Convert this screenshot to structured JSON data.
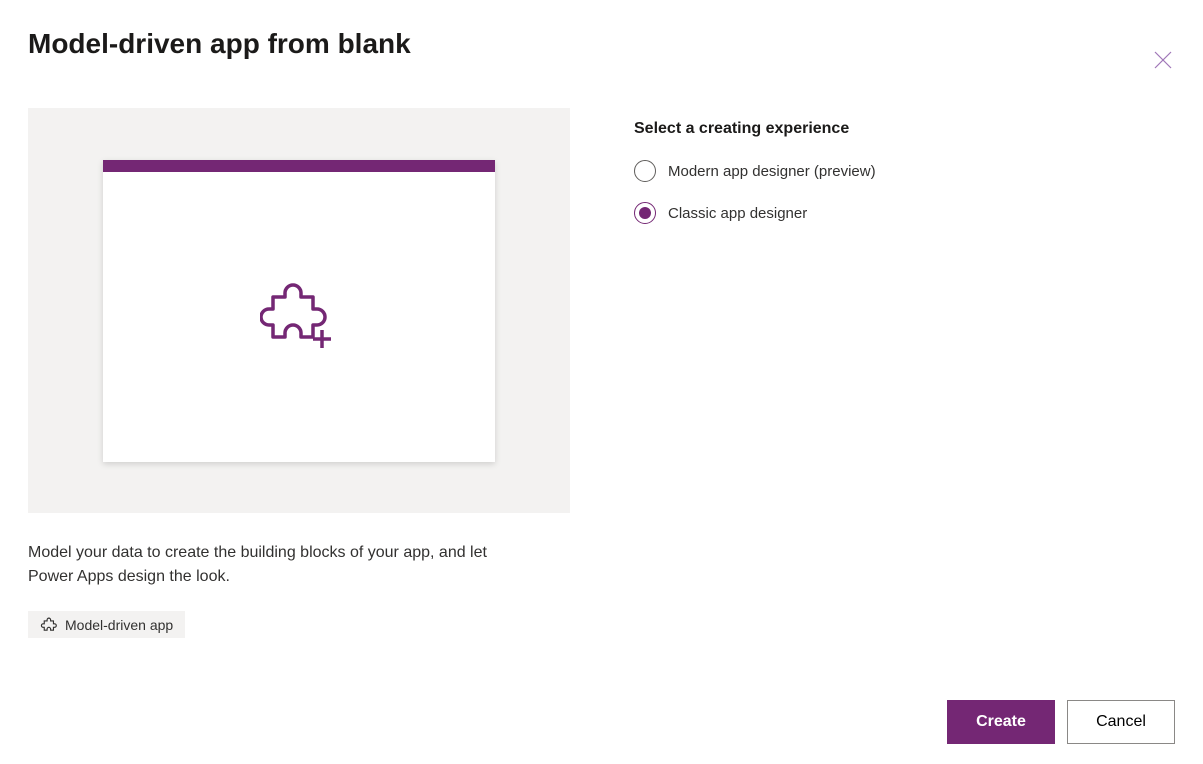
{
  "dialog": {
    "title": "Model-driven app from blank",
    "description": "Model your data to create the building blocks of your app, and let Power Apps design the look.",
    "tag_label": "Model-driven app"
  },
  "options": {
    "section_label": "Select a creating experience",
    "radios": [
      {
        "label": "Modern app designer (preview)",
        "selected": false
      },
      {
        "label": "Classic app designer",
        "selected": true
      }
    ]
  },
  "footer": {
    "create_label": "Create",
    "cancel_label": "Cancel"
  },
  "colors": {
    "accent": "#742774",
    "surface_alt": "#f3f2f1"
  }
}
